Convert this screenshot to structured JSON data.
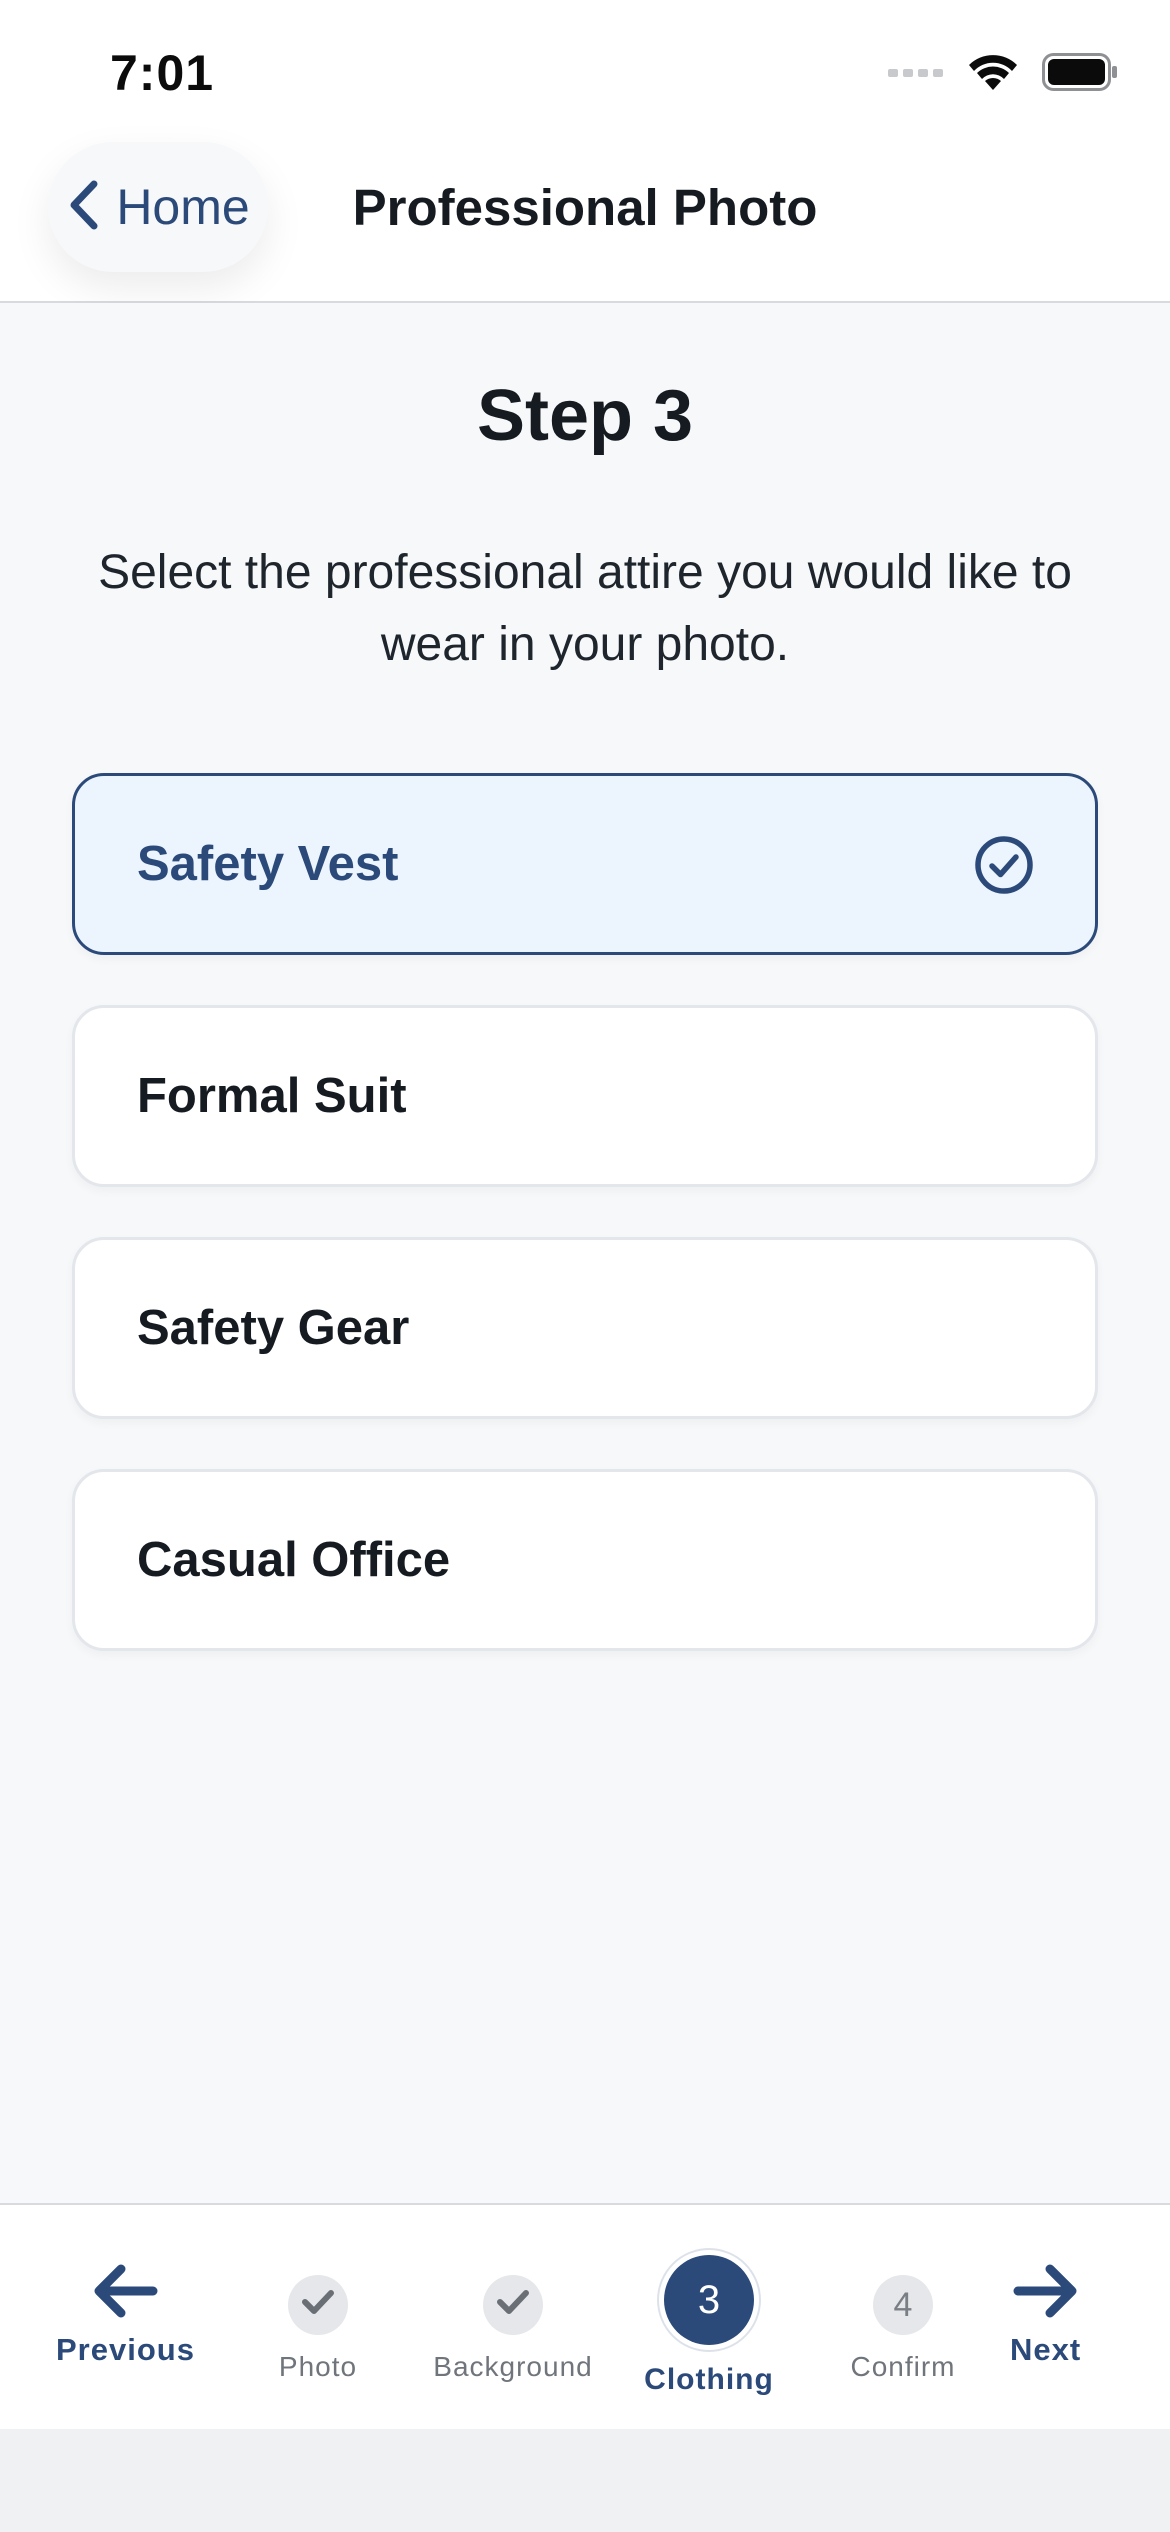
{
  "status_bar": {
    "time": "7:01"
  },
  "nav": {
    "back_label": "Home",
    "title": "Professional Photo"
  },
  "step": {
    "title": "Step 3",
    "description": "Select the professional attire you would like to wear in your photo."
  },
  "options": [
    {
      "label": "Safety Vest",
      "selected": true
    },
    {
      "label": "Formal Suit",
      "selected": false
    },
    {
      "label": "Safety Gear",
      "selected": false
    },
    {
      "label": "Casual Office",
      "selected": false
    }
  ],
  "bottom_nav": {
    "previous_label": "Previous",
    "next_label": "Next",
    "steps": [
      {
        "label": "Photo",
        "state": "completed",
        "indicator": "check-icon"
      },
      {
        "label": "Background",
        "state": "completed",
        "indicator": "check-icon"
      },
      {
        "label": "Clothing",
        "state": "active",
        "number": "3"
      },
      {
        "label": "Confirm",
        "state": "pending",
        "number": "4"
      }
    ]
  },
  "colors": {
    "accent": "#2b4a7a",
    "selected_bg": "#ecf4fd",
    "page_bg": "#f7f8fa",
    "text_primary": "#161b22",
    "inactive_step": "#e5e7ea"
  }
}
